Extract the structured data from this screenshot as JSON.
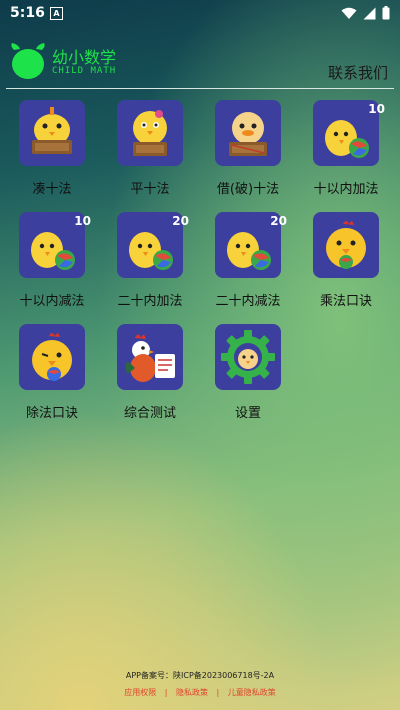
{
  "status": {
    "time": "5:16",
    "a_badge": "A"
  },
  "header": {
    "title": "幼小数学",
    "subtitle": "CHILD MATH",
    "contact": "联系我们",
    "brand_color": "#1ee24a"
  },
  "tiles": [
    {
      "label": "凑十法",
      "badge": "",
      "icon": "chick-sign-icon"
    },
    {
      "label": "平十法",
      "badge": "",
      "icon": "chick-sign-icon"
    },
    {
      "label": "借(破)十法",
      "badge": "",
      "icon": "chick-sign-icon"
    },
    {
      "label": "十以内加法",
      "badge": "10",
      "icon": "chick-ball-icon"
    },
    {
      "label": "十以内减法",
      "badge": "10",
      "icon": "chick-ball-icon"
    },
    {
      "label": "二十内加法",
      "badge": "20",
      "icon": "chick-ball-icon"
    },
    {
      "label": "二十内减法",
      "badge": "20",
      "icon": "chick-ball-icon"
    },
    {
      "label": "乘法口诀",
      "badge": "",
      "icon": "chicken-icon"
    },
    {
      "label": "除法口诀",
      "badge": "",
      "icon": "chicken-icon"
    },
    {
      "label": "综合测试",
      "badge": "",
      "icon": "rooster-icon"
    },
    {
      "label": "设置",
      "badge": "",
      "icon": "gear-icon"
    }
  ],
  "footer": {
    "record": "APP备案号：陕ICP备2023006718号-2A",
    "links": [
      "应用权限",
      "隐私政策",
      "儿童隐私政策"
    ],
    "separator": "|"
  },
  "colors": {
    "tile_bg": "#3d3f9e",
    "chick": "#f7d23a",
    "link": "#e0442d"
  }
}
